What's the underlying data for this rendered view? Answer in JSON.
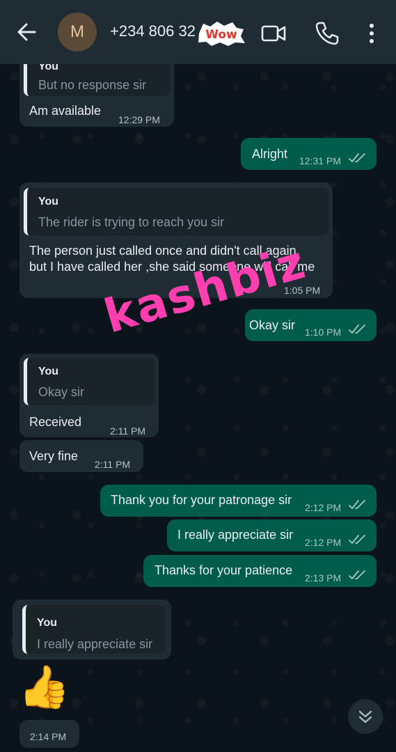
{
  "header": {
    "avatar_letter": "M",
    "contact_name": "+234 806 32",
    "sticker_text": "Wow"
  },
  "icons": [
    "back-arrow-icon",
    "video-call-icon",
    "voice-call-icon",
    "more-vertical-icon",
    "double-check-icon",
    "thumbs-up-emoji",
    "double-chevron-down-icon"
  ],
  "messages": [
    {
      "dir": "in",
      "quote_author": "You",
      "quote_text": "But no response sir",
      "text": "Am available",
      "time": "12:29 PM"
    },
    {
      "dir": "out",
      "text": "Alright",
      "time": "12:31 PM"
    },
    {
      "dir": "in",
      "quote_author": "You",
      "quote_text": "The rider is trying to reach you sir",
      "text_line1": "The person just called once and didn't call again,",
      "text_line2": "but I have called her ,she said someone will call me",
      "time": "1:05 PM"
    },
    {
      "dir": "out",
      "text": "Okay sir",
      "time": "1:10 PM"
    },
    {
      "dir": "in",
      "quote_author": "You",
      "quote_text": "Okay sir",
      "text": "Received",
      "time": "2:11 PM"
    },
    {
      "dir": "in",
      "text": "Very fine",
      "time": "2:11 PM"
    },
    {
      "dir": "out",
      "text": "Thank you for your patronage sir",
      "time": "2:12 PM"
    },
    {
      "dir": "out",
      "text": "I really appreciate sir",
      "time": "2:12 PM"
    },
    {
      "dir": "out",
      "text": "Thanks for your patience",
      "time": "2:13 PM"
    },
    {
      "dir": "in",
      "quote_author": "You",
      "quote_text": "I really appreciate sir",
      "emoji": "👍",
      "time": "2:14 PM"
    }
  ],
  "watermark": "kashbiz",
  "colors": {
    "header_bg": "#1f2c34",
    "incoming_bubble": "#202c33",
    "outgoing_bubble": "#005c4b",
    "watermark": "#ff3fb0",
    "background": "#0b141a"
  }
}
